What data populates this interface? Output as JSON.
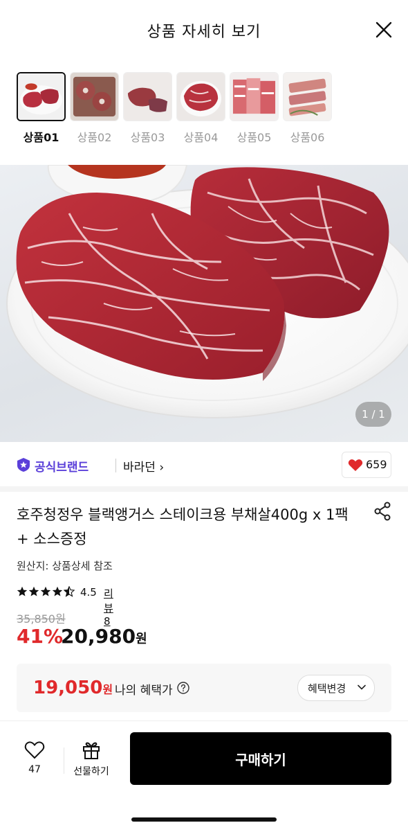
{
  "header": {
    "title": "상품 자세히 보기"
  },
  "thumbnails": [
    {
      "label": "상품01",
      "active": true
    },
    {
      "label": "상품02",
      "active": false
    },
    {
      "label": "상품03",
      "active": false
    },
    {
      "label": "상품04",
      "active": false
    },
    {
      "label": "상품05",
      "active": false
    },
    {
      "label": "상품06",
      "active": false
    }
  ],
  "gallery": {
    "counter": "1 / 1"
  },
  "brand": {
    "badge_label": "공식브랜드",
    "shop_name": "바라던 ›",
    "like_count": "659"
  },
  "product": {
    "title": "호주청정우 블랙앵거스 스테이크용 부채살400g x 1팩 + 소스증정",
    "origin": "원산지: 상품상세 참조",
    "rating": "4.5",
    "rating_value": 4.5,
    "review_link": "리뷰 8",
    "original_price": "35,850원",
    "discount": "41%",
    "price": "20,980",
    "price_unit": "원"
  },
  "benefit": {
    "price": "19,050",
    "price_unit": "원",
    "label": "나의 혜택가",
    "button": "혜택변경"
  },
  "bottom_bar": {
    "wish_count": "47",
    "gift_label": "선물하기",
    "buy_label": "구매하기"
  },
  "colors": {
    "accent": "#e0292b",
    "brand": "#5a3fd9",
    "buy_button": "#000000"
  }
}
